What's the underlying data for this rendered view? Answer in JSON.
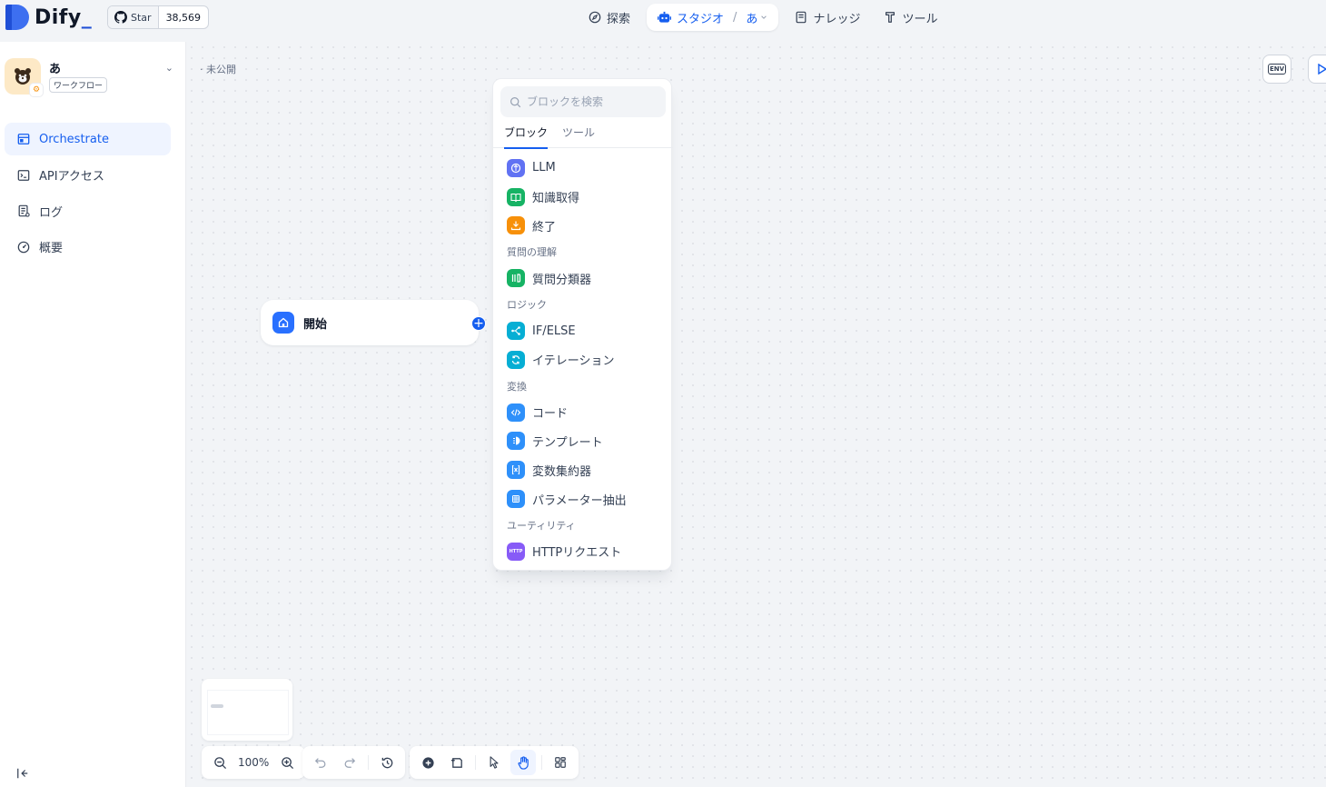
{
  "brand": {
    "name": "Dify"
  },
  "github": {
    "star_label": "Star",
    "star_count": "38,569"
  },
  "nav": {
    "explore": "探索",
    "studio": "スタジオ",
    "studio_app": "あ",
    "knowledge": "ナレッジ",
    "tools": "ツール"
  },
  "app": {
    "name": "あ",
    "type": "ワークフロー"
  },
  "sidebar": {
    "items": [
      {
        "label": "Orchestrate"
      },
      {
        "label": "APIアクセス"
      },
      {
        "label": "ログ"
      },
      {
        "label": "概要"
      }
    ]
  },
  "canvas": {
    "status": "· 未公開",
    "env_label": "ENV",
    "start_node": "開始"
  },
  "picker": {
    "search_placeholder": "ブロックを検索",
    "tabs": [
      "ブロック",
      "ツール"
    ],
    "blocks": {
      "llm": "LLM",
      "knowledge": "知識取得",
      "end": "終了",
      "group_understanding": "質問の理解",
      "classifier": "質問分類器",
      "group_logic": "ロジック",
      "ifelse": "IF/ELSE",
      "iteration": "イテレーション",
      "group_transform": "変換",
      "code": "コード",
      "template": "テンプレート",
      "aggregator": "変数集約器",
      "param": "パラメーター抽出",
      "group_utility": "ユーティリティ",
      "http": "HTTPリクエスト",
      "http_icon_text": "HTTP"
    }
  },
  "toolbar": {
    "zoom": "100%"
  },
  "colors": {
    "accent": "#155eef",
    "llm": "#6172f3",
    "knowledge": "#16b364",
    "end": "#f79009",
    "classifier": "#16b364",
    "ifelse": "#06aed4",
    "iteration": "#06aed4",
    "code": "#2e90fa",
    "template": "#2e90fa",
    "aggregator": "#2e90fa",
    "param": "#2e90fa",
    "http": "#875bf7"
  }
}
